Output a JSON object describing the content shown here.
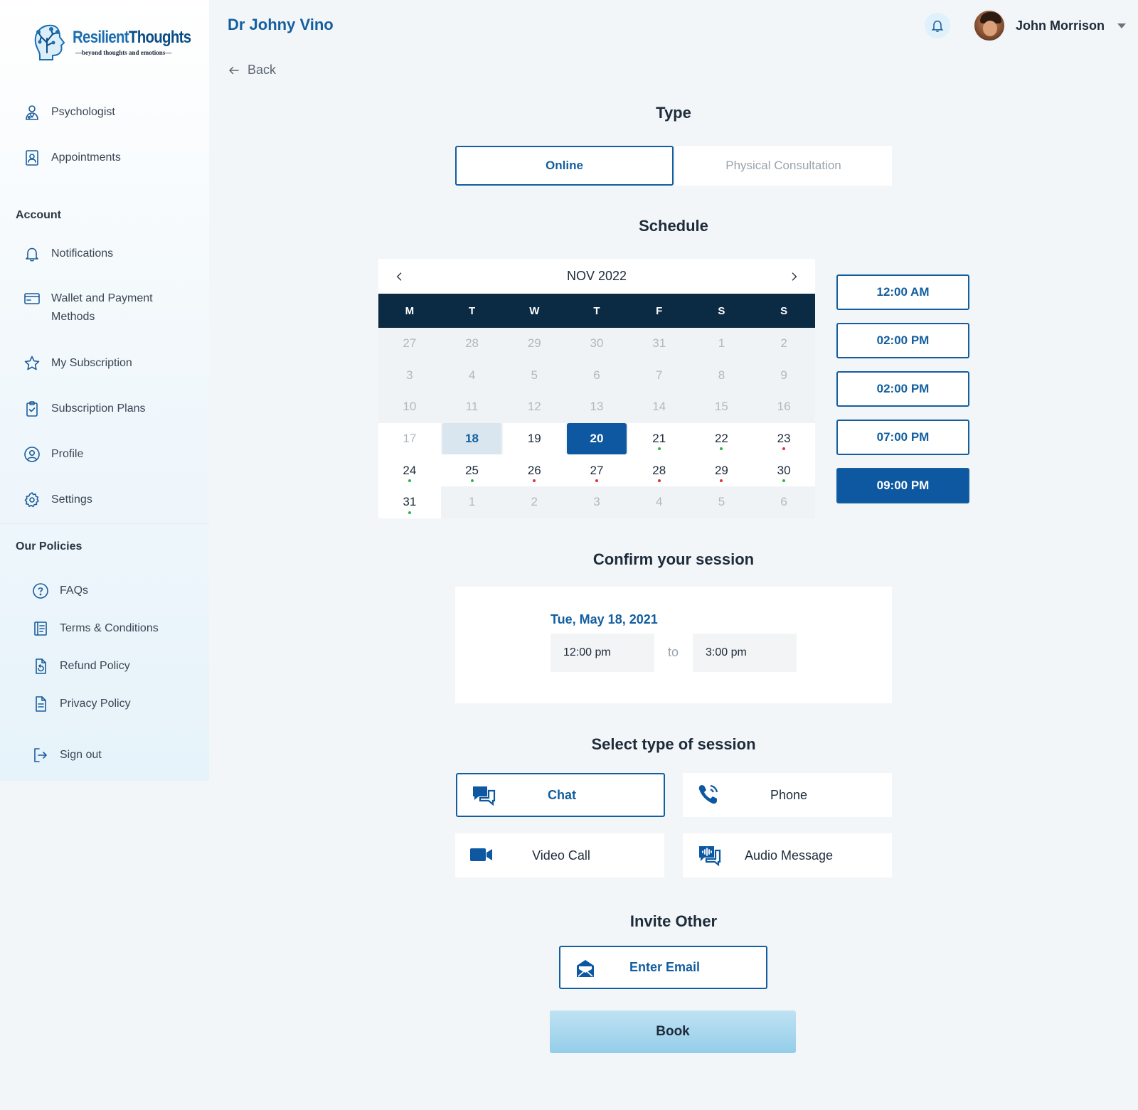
{
  "brand": {
    "name_part1": "Resilient",
    "name_part2": "Thoughts",
    "tagline": "beyond thoughts and emotions"
  },
  "sidebar": {
    "main_items": [
      {
        "label": "Psychologist",
        "icon": "psychologist-icon"
      },
      {
        "label": "Appointments",
        "icon": "appointments-icon"
      }
    ],
    "account_title": "Account",
    "account_items": [
      {
        "label": "Notifications",
        "icon": "bell-icon"
      },
      {
        "label": "Wallet and Payment Methods",
        "icon": "wallet-icon"
      },
      {
        "label": "My Subscription",
        "icon": "star-icon"
      },
      {
        "label": "Subscription Plans",
        "icon": "clipboard-icon"
      },
      {
        "label": "Profile",
        "icon": "profile-icon"
      },
      {
        "label": "Settings",
        "icon": "gear-icon"
      }
    ],
    "policies_title": "Our Policies",
    "policy_items": [
      {
        "label": "FAQs",
        "icon": "question-icon"
      },
      {
        "label": "Terms & Conditions",
        "icon": "document-icon"
      },
      {
        "label": "Refund Policy",
        "icon": "refund-icon"
      },
      {
        "label": "Privacy Policy",
        "icon": "privacy-icon"
      }
    ],
    "signout_label": "Sign out"
  },
  "header": {
    "doctor_name": "Dr Johny Vino",
    "user_name": "John Morrison",
    "back_label": "Back"
  },
  "type_section": {
    "title": "Type",
    "options": [
      "Online",
      "Physical Consultation"
    ],
    "selected": "Online"
  },
  "schedule": {
    "title": "Schedule",
    "month_label": "NOV 2022",
    "weekdays": [
      "M",
      "T",
      "W",
      "T",
      "F",
      "S",
      "S"
    ],
    "weeks": [
      [
        "27",
        "28",
        "29",
        "30",
        "31",
        "1",
        "2"
      ],
      [
        "3",
        "4",
        "5",
        "6",
        "7",
        "8",
        "9"
      ],
      [
        "10",
        "11",
        "12",
        "13",
        "14",
        "15",
        "16"
      ],
      [
        "17",
        "18",
        "19",
        "20",
        "21",
        "22",
        "23"
      ],
      [
        "24",
        "25",
        "26",
        "27",
        "28",
        "29",
        "30"
      ],
      [
        "31",
        "1",
        "2",
        "3",
        "4",
        "5",
        "6"
      ]
    ],
    "time_slots": [
      "12:00 AM",
      "02:00 PM",
      "02:00 PM",
      "07:00 PM",
      "09:00 PM"
    ],
    "selected_slot": "09:00 PM"
  },
  "confirm": {
    "title": "Confirm your session",
    "date": "Tue, May 18, 2021",
    "start_time": "12:00 pm",
    "to_label": "to",
    "end_time": "3:00 pm"
  },
  "session_types": {
    "title": "Select type of session",
    "options": [
      {
        "label": "Chat",
        "icon": "chat-icon"
      },
      {
        "label": "Phone",
        "icon": "phone-icon"
      },
      {
        "label": "Video Call",
        "icon": "video-icon"
      },
      {
        "label": "Audio Message",
        "icon": "audio-message-icon"
      }
    ],
    "selected": "Chat"
  },
  "invite": {
    "title": "Invite Other",
    "email_placeholder": "Enter Email"
  },
  "book_label": "Book",
  "colors": {
    "primary": "#0d58a0",
    "accent_text": "#135e9f",
    "calendar_header": "#0b2a44",
    "book_button": "#a6d6ee",
    "available_dot": "#2cb34a",
    "busy_dot": "#e0313a"
  }
}
